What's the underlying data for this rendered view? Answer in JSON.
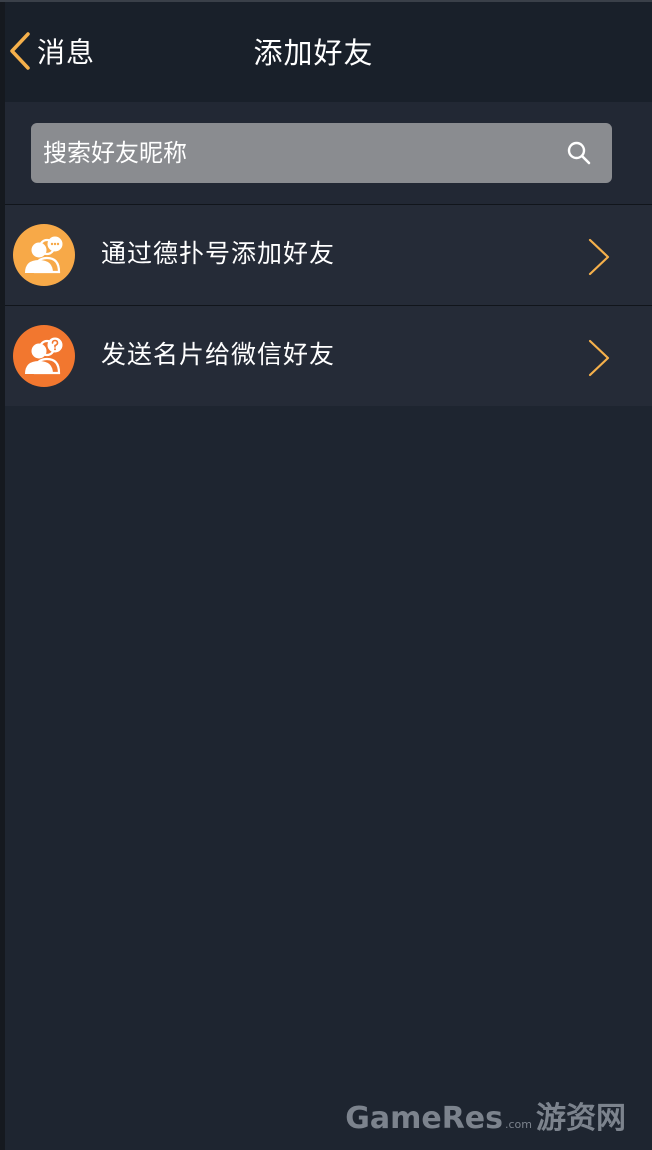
{
  "nav": {
    "back_label": "消息",
    "title": "添加好友"
  },
  "search": {
    "placeholder": "搜索好友昵称"
  },
  "options": [
    {
      "label": "通过德扑号添加好友",
      "icon": "users-chat-icon",
      "color": "#f7a948"
    },
    {
      "label": "发送名片给微信好友",
      "icon": "users-question-icon",
      "color": "#f2772f"
    }
  ],
  "watermark": {
    "brand": "GameRes",
    "suffix": ".com",
    "cn": "游资网"
  },
  "colors": {
    "accent": "#f5b04b",
    "background": "#1e2530",
    "nav_bar": "#19202a",
    "list_item": "#252b37",
    "search_field": "#8a8c90"
  }
}
